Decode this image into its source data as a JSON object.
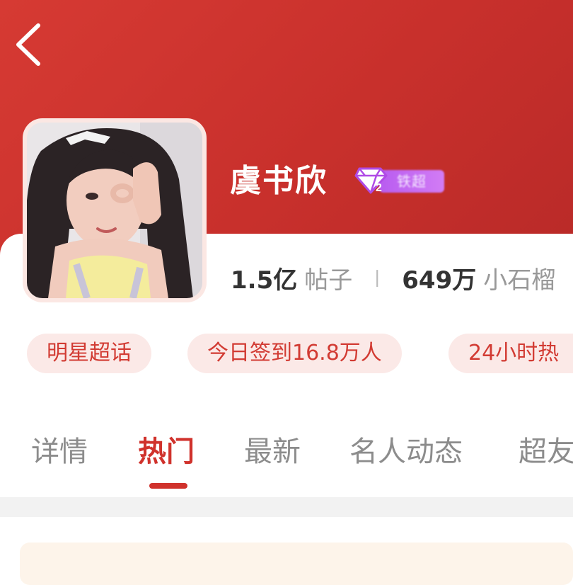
{
  "nav": {
    "back_icon": "chevron-left-icon"
  },
  "topic": {
    "name": "虞书欣",
    "level_badge": {
      "level": "2",
      "label": "铁超",
      "icon": "diamond-icon"
    }
  },
  "stats": {
    "posts_value": "1.5亿",
    "posts_label": "帖子",
    "separator": "丨",
    "fans_value": "649万",
    "fans_label": "小石榴"
  },
  "tags": [
    "明星超话",
    "今日签到16.8万人",
    "24小时热"
  ],
  "tabs": [
    {
      "label": "详情",
      "active": false
    },
    {
      "label": "热门",
      "active": true
    },
    {
      "label": "最新",
      "active": false
    },
    {
      "label": "名人动态",
      "active": false
    },
    {
      "label": "超友",
      "active": false
    }
  ],
  "colors": {
    "header": "#d63a33",
    "accent": "#d0322c",
    "pill_bg": "#fbe9e7",
    "badge": "#c46af2"
  }
}
